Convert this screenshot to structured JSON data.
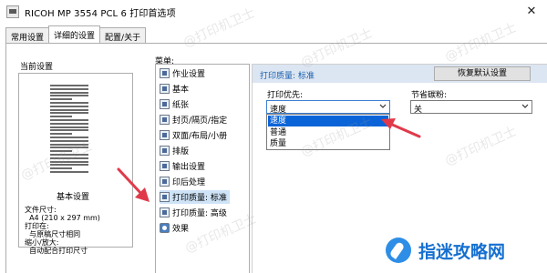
{
  "window": {
    "title": "RICOH MP 3554 PCL 6 打印首选项",
    "close_symbol": "✕"
  },
  "tabs": [
    {
      "label": "常用设置"
    },
    {
      "label": "详细的设置"
    },
    {
      "label": "配置/关于"
    }
  ],
  "left_panel": {
    "current_label": "当前设置",
    "preview_title": "基本设置",
    "info_lines": [
      "文件尺寸:",
      "  A4 (210 x 297 mm)",
      "打印在:",
      "  与原稿尺寸相同",
      "缩小/放大:",
      "  自动配合打印尺寸"
    ]
  },
  "menu": {
    "label": "菜单:",
    "items": [
      {
        "label": "作业设置",
        "icon": "job-settings-icon"
      },
      {
        "label": "基本",
        "icon": "basic-icon"
      },
      {
        "label": "纸张",
        "icon": "paper-icon"
      },
      {
        "label": "封页/隔页/指定",
        "icon": "cover-sheet-icon"
      },
      {
        "label": "双面/布局/小册",
        "icon": "duplex-layout-icon"
      },
      {
        "label": "排版",
        "icon": "layout-icon"
      },
      {
        "label": "输出设置",
        "icon": "output-icon"
      },
      {
        "label": "印后处理",
        "icon": "finishing-icon"
      },
      {
        "label": "打印质量: 标准",
        "icon": "print-quality-icon",
        "selected": true
      },
      {
        "label": "打印质量: 高级",
        "icon": "print-quality-advanced-icon"
      },
      {
        "label": "效果",
        "icon": "effects-icon"
      }
    ]
  },
  "settings": {
    "header_title": "打印质量: 标准",
    "restore_label": "恢复默认设置",
    "priority_label": "打印优先:",
    "priority_value": "速度",
    "priority_options": [
      "速度",
      "普通",
      "质量"
    ],
    "priority_highlighted": "速度",
    "toner_label": "节省碳粉:",
    "toner_value": "关"
  },
  "watermark": {
    "text": "@打印机卫士"
  },
  "brand": {
    "name": "指迷攻略网"
  },
  "colors": {
    "accent": "#0a64d8",
    "header_bg": "#dce6f2",
    "header_text": "#1b5fae",
    "arrow": "#e03a4a",
    "selected_row": "#cfe3f7",
    "brand": "#156fd1"
  }
}
